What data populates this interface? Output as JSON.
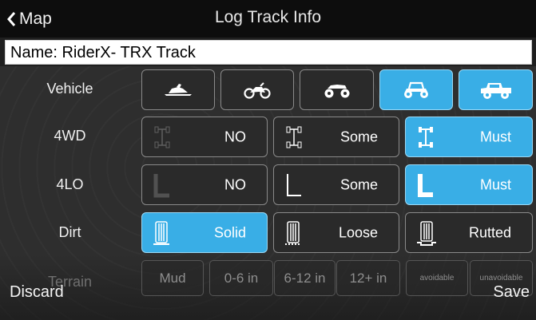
{
  "header": {
    "back_label": "Map",
    "title": "Log Track Info"
  },
  "name_field": {
    "value": "Name: RiderX- TRX Track"
  },
  "rows": {
    "vehicle": {
      "label": "Vehicle",
      "options": [
        "snowmobile-icon",
        "dirtbike-icon",
        "atv-icon",
        "utv-icon",
        "jeep-icon"
      ],
      "selected": 3
    },
    "fourwd": {
      "label": "4WD",
      "options": [
        "NO",
        "Some",
        "Must"
      ],
      "selected": 2
    },
    "fourlo": {
      "label": "4LO",
      "options": [
        "NO",
        "Some",
        "Must"
      ],
      "selected": 2
    },
    "dirt": {
      "label": "Dirt",
      "options": [
        "Solid",
        "Loose",
        "Rutted"
      ],
      "selected": 0
    },
    "terrain": {
      "label": "Terrain",
      "options": [
        "Mud",
        "0-6 in",
        "6-12 in",
        "12+ in",
        "avoidable",
        "unavoidable"
      ]
    }
  },
  "footer": {
    "discard_label": "Discard",
    "save_label": "Save"
  },
  "colors": {
    "accent": "#39aee6",
    "background": "#2e2e2e",
    "topbar": "#0d0d0d"
  }
}
